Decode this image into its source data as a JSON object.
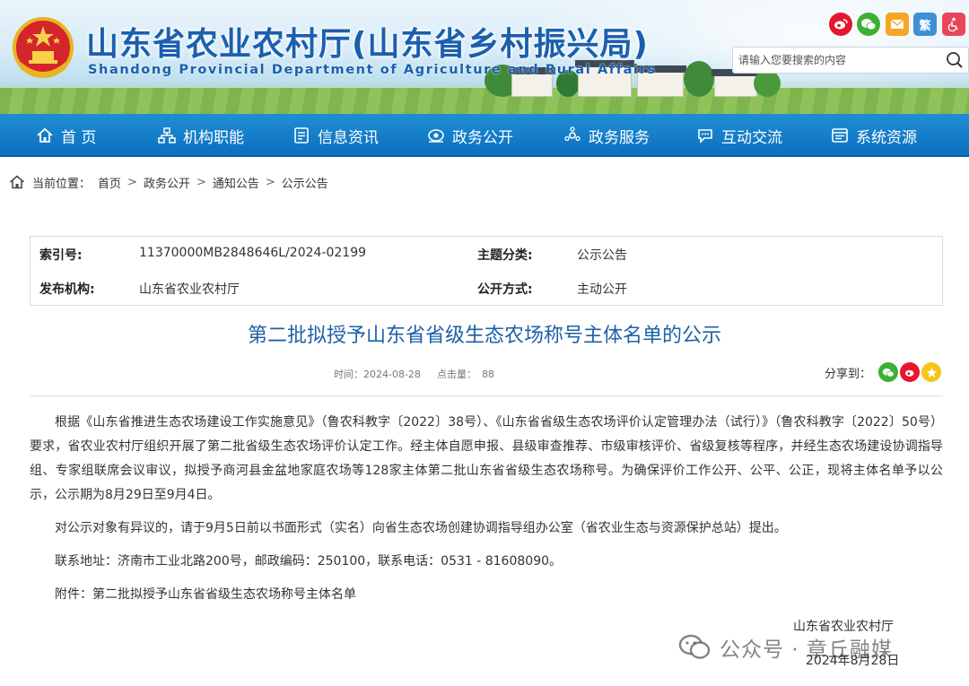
{
  "header": {
    "title_cn": "山东省农业农村厅(山东省乡村振兴局)",
    "title_en": "Shandong Provincial Department of Agriculture and Rural Affairs",
    "traditional_label": "繁",
    "search_placeholder": "请输入您要搜索的内容",
    "colors": {
      "brand_blue": "#1b5fae",
      "weibo": "#e6162d",
      "wechat": "#3cb034",
      "mail": "#f5a623",
      "traditional": "#3d8fd6",
      "accessibility": "#e8455a"
    }
  },
  "nav": {
    "items": [
      {
        "label": "首 页",
        "icon": "home-icon"
      },
      {
        "label": "机构职能",
        "icon": "org-chart-icon"
      },
      {
        "label": "信息资讯",
        "icon": "document-icon"
      },
      {
        "label": "政务公开",
        "icon": "eye-icon"
      },
      {
        "label": "政务服务",
        "icon": "service-icon"
      },
      {
        "label": "互动交流",
        "icon": "chat-icon"
      },
      {
        "label": "系统资源",
        "icon": "resource-icon"
      }
    ]
  },
  "breadcrumb": {
    "prefix": "当前位置：",
    "items": [
      "首页",
      "政务公开",
      "通知公告",
      "公示公告"
    ],
    "separator": ">"
  },
  "meta": {
    "index_label": "索引号:",
    "index_value": "11370000MB2848646L/2024-02199",
    "category_label": "主题分类:",
    "category_value": "公示公告",
    "publisher_label": "发布机构:",
    "publisher_value": "山东省农业农村厅",
    "method_label": "公开方式:",
    "method_value": "主动公开"
  },
  "article": {
    "title": "第二批拟授予山东省省级生态农场称号主体名单的公示",
    "time_label": "时间：",
    "time_value": "2024-08-28",
    "clicks_label": "点击量：",
    "clicks_value": "88",
    "share_label": "分享到：",
    "paragraphs": [
      "根据《山东省推进生态农场建设工作实施意见》（鲁农科教字〔2022〕38号）、《山东省省级生态农场评价认定管理办法（试行）》（鲁农科教字〔2022〕50号）要求，省农业农村厅组织开展了第二批省级生态农场评价认定工作。经主体自愿申报、县级审查推荐、市级审核评价、省级复核等程序，并经生态农场建设协调指导组、专家组联席会议审议，拟授予商河县金盆地家庭农场等128家主体第二批山东省省级生态农场称号。为确保评价工作公开、公平、公正，现将主体名单予以公示，公示期为8月29日至9月4日。",
      "对公示对象有异议的，请于9月5日前以书面形式（实名）向省生态农场创建协调指导组办公室（省农业生态与资源保护总站）提出。",
      "联系地址：济南市工业北路200号，邮政编码：250100，联系电话：0531 - 81608090。",
      "附件：第二批拟授予山东省省级生态农场称号主体名单"
    ],
    "sign_org": "山东省农业农村厅",
    "sign_date": "2024年8月28日"
  },
  "watermark": {
    "text": "公众号 · 章丘融媒"
  }
}
